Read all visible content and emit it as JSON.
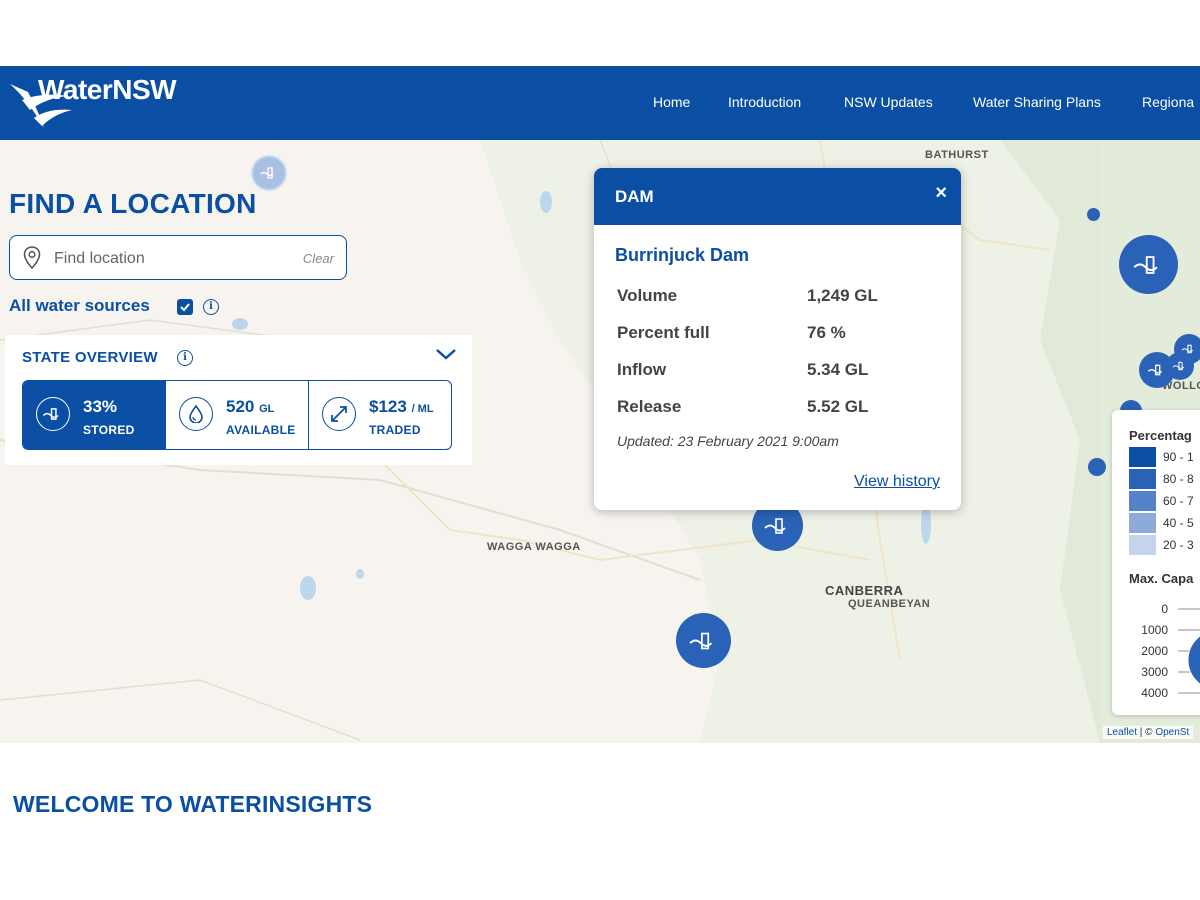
{
  "header": {
    "brand": "WaterNSW",
    "nav": [
      "Home",
      "Introduction",
      "NSW Updates",
      "Water Sharing Plans",
      "Regiona"
    ]
  },
  "map": {
    "places": {
      "bathurst": "BATHURST",
      "wagga": "WAGGA WAGGA",
      "canberra": "CANBERRA",
      "queanbeyan": "QUEANBEYAN",
      "wollo": "WOLLO"
    }
  },
  "find": {
    "title": "FIND A LOCATION",
    "placeholder": "Find location",
    "clear": "Clear",
    "sources": "All water sources"
  },
  "state_overview": {
    "title": "STATE OVERVIEW",
    "stats": [
      {
        "value": "33%",
        "unit": "",
        "label": "STORED",
        "icon": "dam-icon"
      },
      {
        "value": "520",
        "unit": "GL",
        "label": "AVAILABLE",
        "icon": "water-drop-icon"
      },
      {
        "value": "$123",
        "unit": "/ ML",
        "label": "TRADED",
        "icon": "trade-arrows-icon"
      }
    ]
  },
  "popup": {
    "title": "DAM",
    "close": "×",
    "name": "Burrinjuck Dam",
    "rows": [
      {
        "label": "Volume",
        "value": "1,249 GL"
      },
      {
        "label": "Percent full",
        "value": "76 %"
      },
      {
        "label": "Inflow",
        "value": "5.34 GL"
      },
      {
        "label": "Release",
        "value": "5.52 GL"
      }
    ],
    "updated": "Updated: 23 February 2021 9:00am",
    "link": "View history"
  },
  "legend": {
    "title": "Percentag",
    "bins": [
      {
        "label": "90 - 1",
        "color": "#0a4fa3"
      },
      {
        "label": "80 - 8",
        "color": "#2a62b8"
      },
      {
        "label": "60 - 7",
        "color": "#5582c6"
      },
      {
        "label": "40 - 5",
        "color": "#8eaad8"
      },
      {
        "label": "20 - 3",
        "color": "#c5d4ec"
      }
    ],
    "capacity_title": "Max. Capa",
    "capacity_ticks": [
      "0",
      "1000",
      "2000",
      "3000",
      "4000"
    ]
  },
  "attribution": {
    "leaflet": "Leaflet",
    "sep": " | © ",
    "osm": "OpenSt"
  },
  "welcome": "WELCOME TO WATERINSIGHTS"
}
